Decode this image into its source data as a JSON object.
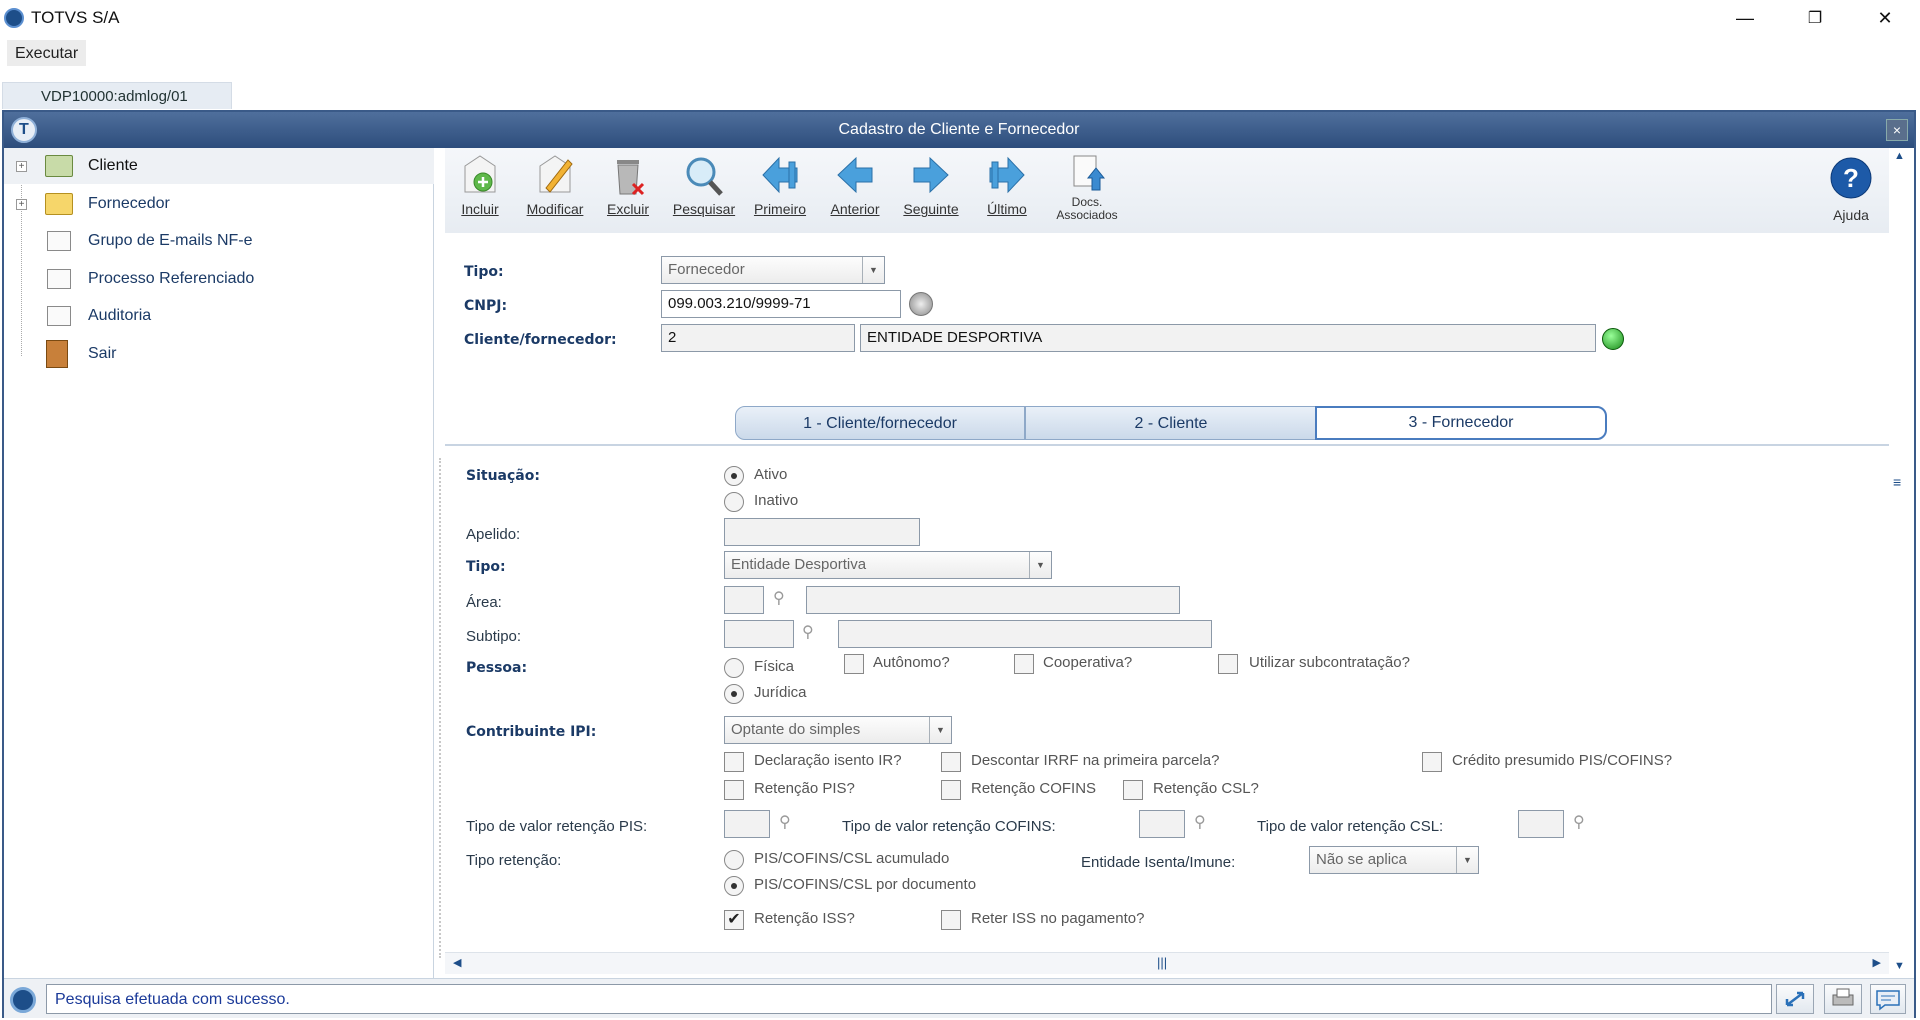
{
  "window": {
    "title": "TOTVS S/A",
    "minimize": "—",
    "restore": "❐",
    "close": "✕"
  },
  "menu": {
    "executar": "Executar"
  },
  "session_tab": "VDP10000:admlog/01",
  "frame": {
    "title": "Cadastro de Cliente e Fornecedor",
    "close": "×"
  },
  "sidebar": {
    "items": [
      {
        "label": "Cliente"
      },
      {
        "label": "Fornecedor"
      },
      {
        "label": "Grupo de E-mails NF-e"
      },
      {
        "label": "Processo Referenciado"
      },
      {
        "label": "Auditoria"
      },
      {
        "label": "Sair"
      }
    ]
  },
  "toolbar": {
    "incluir": "Incluir",
    "modificar": "Modificar",
    "excluir": "Excluir",
    "pesquisar": "Pesquisar",
    "primeiro": "Primeiro",
    "anterior": "Anterior",
    "seguinte": "Seguinte",
    "ultimo": "Último",
    "docs_line1": "Docs.",
    "docs_line2": "Associados",
    "ajuda": "Ajuda"
  },
  "header_form": {
    "tipo_label": "Tipo:",
    "tipo_value": "Fornecedor",
    "cnpj_label": "CNPJ:",
    "cnpj_value": "099.003.210/9999-71",
    "cliente_label": "Cliente/fornecedor:",
    "cliente_code": "2",
    "cliente_name": "ENTIDADE DESPORTIVA"
  },
  "tabs": [
    {
      "label": "1 - Cliente/fornecedor"
    },
    {
      "label": "2 - Cliente"
    },
    {
      "label": "3 - Fornecedor"
    }
  ],
  "panel": {
    "situacao_label": "Situação:",
    "ativo": "Ativo",
    "inativo": "Inativo",
    "situacao_selected": "Ativo",
    "apelido_label": "Apelido:",
    "apelido_value": "",
    "tipo_label": "Tipo:",
    "tipo_value": "Entidade Desportiva",
    "area_label": "Área:",
    "subtipo_label": "Subtipo:",
    "pessoa_label": "Pessoa:",
    "fisica": "Física",
    "juridica": "Jurídica",
    "pessoa_selected": "Jurídica",
    "autonomo": "Autônomo?",
    "cooperativa": "Cooperativa?",
    "subcontratacao": "Utilizar subcontratação?",
    "contribuinte_label": "Contribuinte IPI:",
    "contribuinte_value": "Optante do simples",
    "decl_isento": "Declaração isento IR?",
    "descontar_irrf": "Descontar IRRF na primeira parcela?",
    "credito_presumido": "Crédito presumido PIS/COFINS?",
    "retencao_pis": "Retenção PIS?",
    "retencao_cofins": "Retenção COFINS",
    "retencao_csl": "Retenção CSL?",
    "tipo_val_pis": "Tipo de valor retenção PIS:",
    "tipo_val_cofins": "Tipo de valor retenção COFINS:",
    "tipo_val_csl": "Tipo de valor retenção CSL:",
    "tipo_retencao_label": "Tipo retenção:",
    "acumulado": "PIS/COFINS/CSL acumulado",
    "por_documento": "PIS/COFINS/CSL por documento",
    "tipo_retencao_selected": "PIS/COFINS/CSL por documento",
    "entidade_isenta_label": "Entidade Isenta/Imune:",
    "entidade_isenta_value": "Não se aplica",
    "retencao_iss": "Retenção ISS?",
    "retencao_iss_checked": true,
    "reter_iss_pagamento": "Reter ISS no pagamento?"
  },
  "status": {
    "text": "Pesquisa efetuada com sucesso."
  },
  "colors": {
    "header": "#3a5a88",
    "link": "#1b3a66",
    "status_text": "#1b3a99"
  }
}
